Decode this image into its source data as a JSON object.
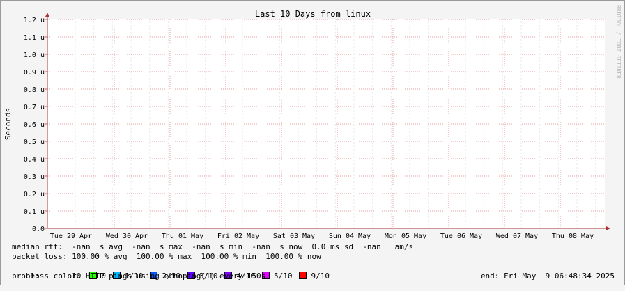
{
  "chart_data": {
    "type": "line",
    "title": "Last 10 Days from linux",
    "ylabel": "Seconds",
    "watermark": "RRDTOOL / TOBI OETIKER",
    "y_ticks": [
      "0.0",
      "0.1 u",
      "0.2 u",
      "0.3 u",
      "0.4 u",
      "0.5 u",
      "0.6 u",
      "0.7 u",
      "0.8 u",
      "0.9 u",
      "1.0 u",
      "1.1 u",
      "1.2 u"
    ],
    "ylim": [
      0,
      1.2
    ],
    "x_ticks": [
      "Tue 29 Apr",
      "Wed 30 Apr",
      "Thu 01 May",
      "Fri 02 May",
      "Sat 03 May",
      "Sun 04 May",
      "Mon 05 May",
      "Tue 06 May",
      "Wed 07 May",
      "Thu 08 May"
    ],
    "grid": true,
    "series": []
  },
  "legend": {
    "median_rtt": "median rtt:  -nan  s avg  -nan  s max  -nan  s min  -nan  s now  0.0 ms sd  -nan   am/s",
    "packet_loss": "packet loss: 100.00 % avg  100.00 % max  100.00 % min  100.00 % now",
    "loss_color_label": "loss color:",
    "loss_colors": [
      {
        "label": "0",
        "color": "#26ff00"
      },
      {
        "label": "1/10",
        "color": "#00b8ff"
      },
      {
        "label": "2/10",
        "color": "#0059ff"
      },
      {
        "label": "3/10",
        "color": "#5e00ff"
      },
      {
        "label": "4/10",
        "color": "#7e00ff"
      },
      {
        "label": "5/10",
        "color": "#dd00ff"
      },
      {
        "label": "9/10",
        "color": "#ff0000"
      }
    ],
    "probe": "probe:       10 HTTP pings using echoping(1) every 150s",
    "end": "end: Fri May  9 06:48:34 2025"
  }
}
